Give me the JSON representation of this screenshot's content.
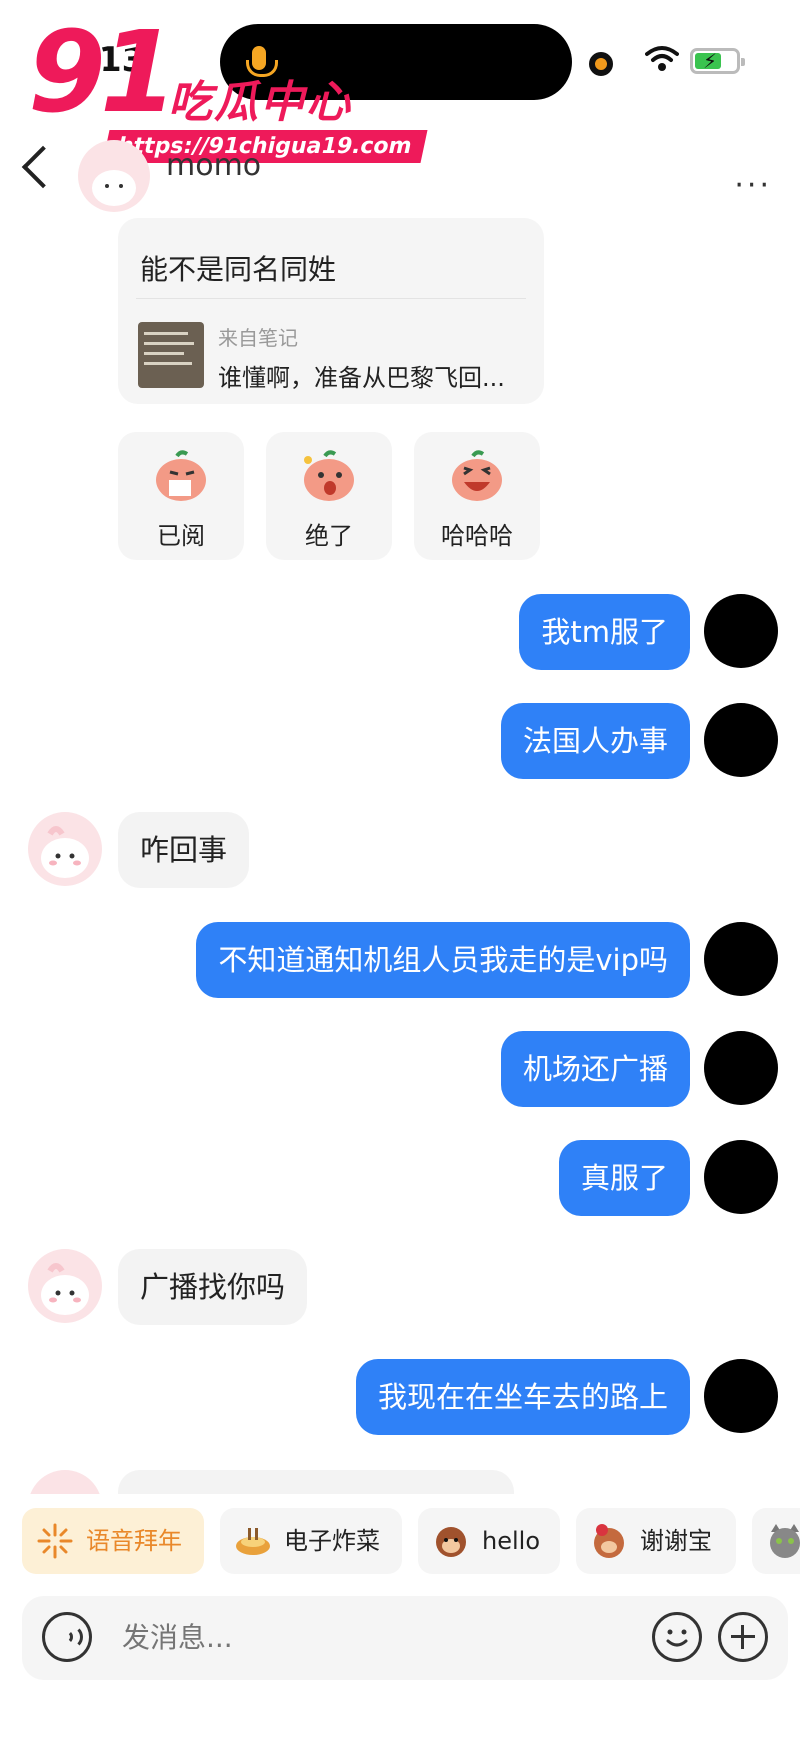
{
  "status_bar": {
    "time": "13"
  },
  "watermark": {
    "number": "91",
    "name": "吃瓜中心",
    "url": "https://91chigua19.com"
  },
  "header": {
    "contact_name": "momo",
    "more": "···"
  },
  "shared_note": {
    "text": "能不是同名同姓",
    "source_label": "来自笔记",
    "title": "谁懂啊，准备从巴黎飞回..."
  },
  "stickers": [
    {
      "label": "已阅"
    },
    {
      "label": "绝了"
    },
    {
      "label": "哈哈哈"
    }
  ],
  "messages": [
    {
      "from": "me",
      "text": "我tm服了"
    },
    {
      "from": "me",
      "text": "法国人办事"
    },
    {
      "from": "them",
      "text": "咋回事"
    },
    {
      "from": "me",
      "text": "不知道通知机组人员我走的是vip吗"
    },
    {
      "from": "me",
      "text": "机场还广播"
    },
    {
      "from": "me",
      "text": "真服了"
    },
    {
      "from": "them",
      "text": "广播找你吗"
    },
    {
      "from": "me",
      "text": "我现在在坐车去的路上"
    }
  ],
  "quick_replies": [
    {
      "label": "语音拜年",
      "icon": "sparkle-icon"
    },
    {
      "label": "电子炸菜",
      "icon": "dish-icon"
    },
    {
      "label": "hello",
      "icon": "monkey-icon"
    },
    {
      "label": "谢谢宝",
      "icon": "thanks-sticker-icon"
    }
  ],
  "input": {
    "placeholder": "发消息..."
  },
  "colors": {
    "my_bubble": "#2f81f7",
    "their_bubble": "#f3f3f3",
    "watermark": "#ee1a5a"
  }
}
